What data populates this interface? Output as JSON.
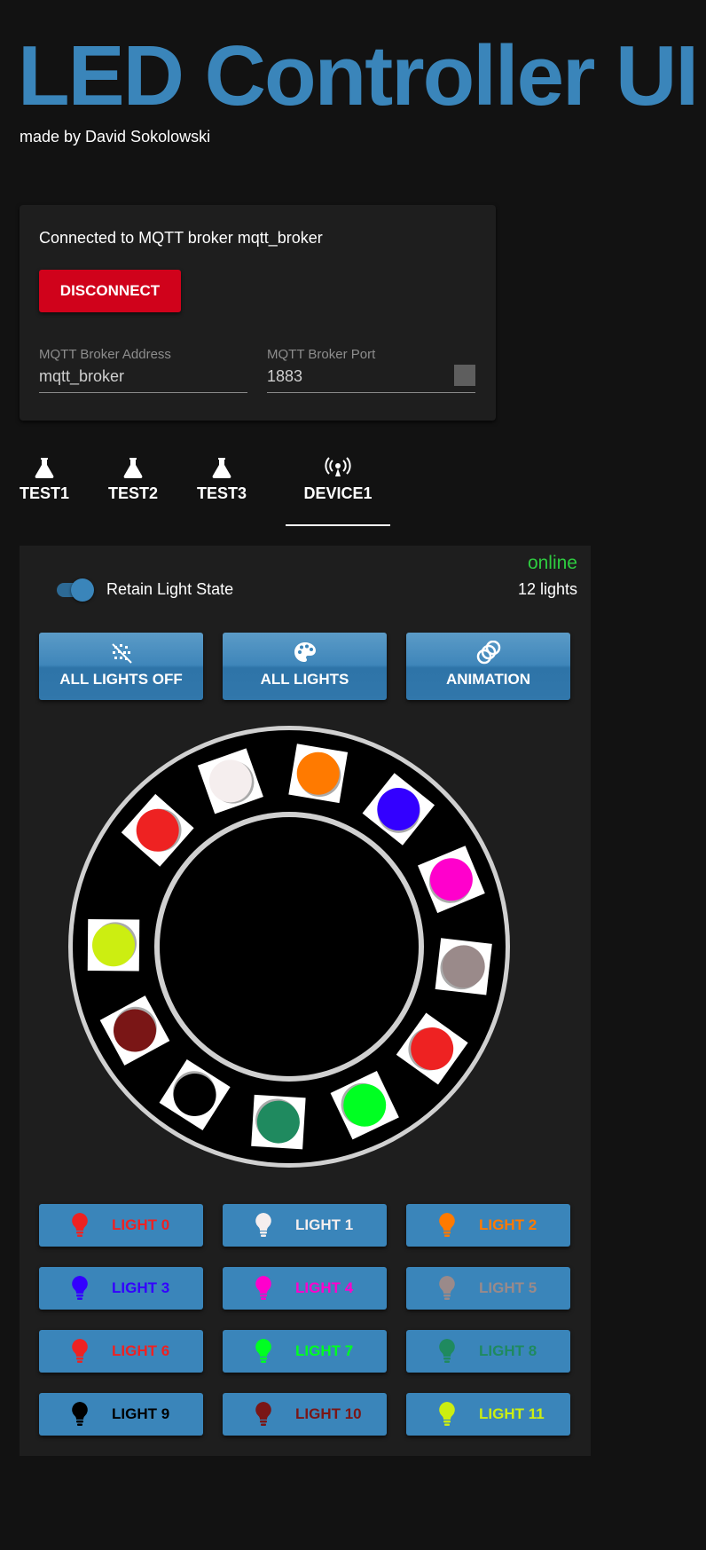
{
  "header": {
    "title": "LED Controller UI",
    "subtitle": "made by David Sokolowski"
  },
  "connection": {
    "status_text": "Connected to MQTT broker mqtt_broker",
    "disconnect_label": "DISCONNECT",
    "address_label": "MQTT Broker Address",
    "address_value": "mqtt_broker",
    "port_label": "MQTT Broker Port",
    "port_value": "1883"
  },
  "tabs": [
    {
      "label": "TEST1",
      "icon": "flask-icon"
    },
    {
      "label": "TEST2",
      "icon": "flask-icon"
    },
    {
      "label": "TEST3",
      "icon": "flask-icon"
    },
    {
      "label": "DEVICE1",
      "icon": "broadcast-icon",
      "active": true
    }
  ],
  "device": {
    "status": "online",
    "status_color": "#2ecc40",
    "light_count": "12 lights",
    "retain_label": "Retain Light State",
    "retain_on": true,
    "modes": [
      {
        "label": "ALL LIGHTS OFF",
        "icon": "lights-off-icon"
      },
      {
        "label": "ALL LIGHTS",
        "icon": "palette-icon"
      },
      {
        "label": "ANIMATION",
        "icon": "animation-rings-icon"
      }
    ],
    "lights": [
      {
        "label": "LIGHT 0",
        "color": "#ee2222"
      },
      {
        "label": "LIGHT 1",
        "color": "#f5eeee"
      },
      {
        "label": "LIGHT 2",
        "color": "#ff7a00"
      },
      {
        "label": "LIGHT 3",
        "color": "#3300ff"
      },
      {
        "label": "LIGHT 4",
        "color": "#ff00cc"
      },
      {
        "label": "LIGHT 5",
        "color": "#9a8a8a"
      },
      {
        "label": "LIGHT 6",
        "color": "#ee2222"
      },
      {
        "label": "LIGHT 7",
        "color": "#00ff22"
      },
      {
        "label": "LIGHT 8",
        "color": "#1f8a5f"
      },
      {
        "label": "LIGHT 9",
        "color": "#000000"
      },
      {
        "label": "LIGHT 10",
        "color": "#7a1616"
      },
      {
        "label": "LIGHT 11",
        "color": "#ccee11"
      }
    ]
  }
}
